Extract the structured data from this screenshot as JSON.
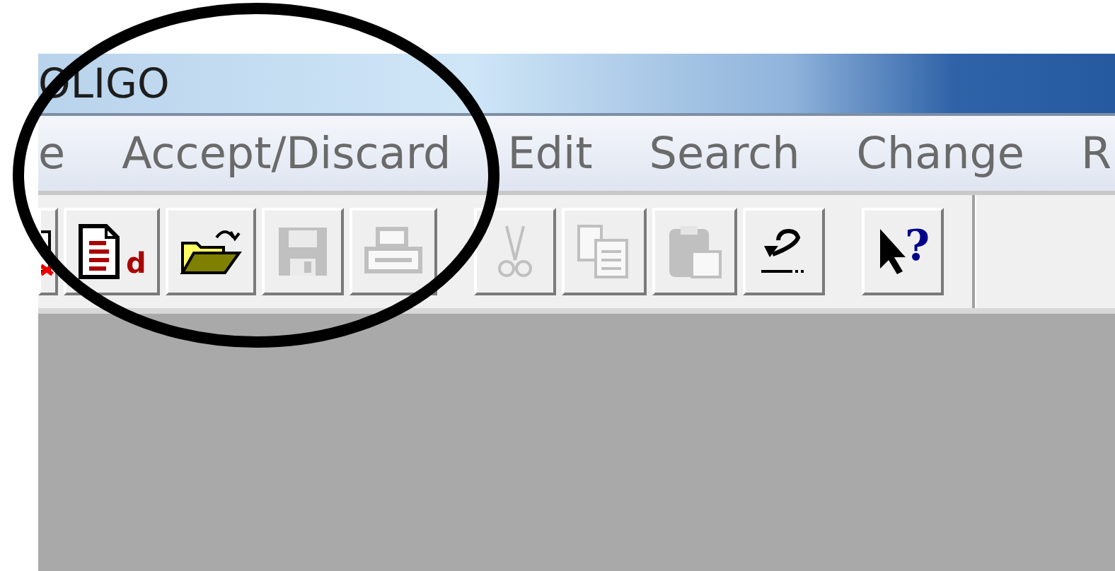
{
  "window": {
    "title": "OLIGO"
  },
  "menu": [
    {
      "label": "e"
    },
    {
      "label": "Accept/Discard"
    },
    {
      "label": "Edit"
    },
    {
      "label": "Search"
    },
    {
      "label": "Change"
    },
    {
      "label": "R"
    }
  ],
  "toolbar_groups": [
    [
      {
        "kind": "red-doc",
        "disabled": false
      },
      {
        "kind": "new-doc",
        "badge": "d",
        "disabled": false
      },
      {
        "kind": "open",
        "disabled": false
      },
      {
        "kind": "save",
        "disabled": true
      },
      {
        "kind": "print",
        "disabled": true
      }
    ],
    [
      {
        "kind": "cut",
        "disabled": true
      },
      {
        "kind": "copy",
        "disabled": true
      },
      {
        "kind": "paste",
        "disabled": true
      },
      {
        "kind": "undo",
        "disabled": false
      }
    ],
    [
      {
        "kind": "help",
        "badge": "?",
        "disabled": false
      }
    ]
  ]
}
